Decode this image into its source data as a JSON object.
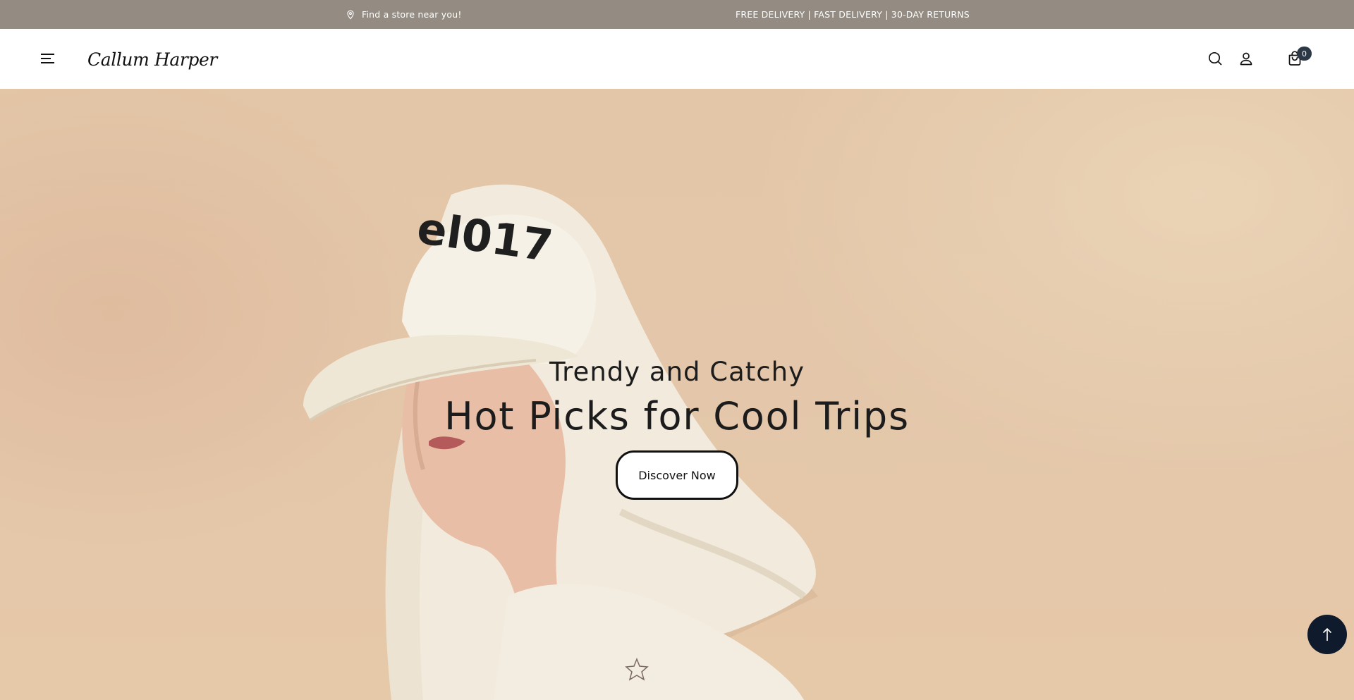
{
  "announcement": {
    "store_link": "Find a store near you!",
    "store_icon": "map-pin-icon",
    "delivery_text": "FREE DELIVERY | FAST DELIVERY | 30-DAY RETURNS"
  },
  "header": {
    "menu_icon": "hamburger-menu-icon",
    "logo_text": "Callum Harper",
    "search_icon": "search-icon",
    "account_icon": "user-icon",
    "cart_icon": "shopping-bag-icon",
    "cart_count": "0"
  },
  "hero": {
    "eyebrow": "Trendy and Catchy",
    "headline": "Hot Picks for Cool Trips",
    "cta_label": "Discover Now",
    "cap_text": "el017"
  },
  "back_to_top_icon": "arrow-up-icon",
  "colors": {
    "topbar_bg": "#948c82",
    "hero_bg": "#e3c6a7",
    "badge_bg": "#2d3847",
    "back_to_top_bg": "#0f1a2c"
  }
}
